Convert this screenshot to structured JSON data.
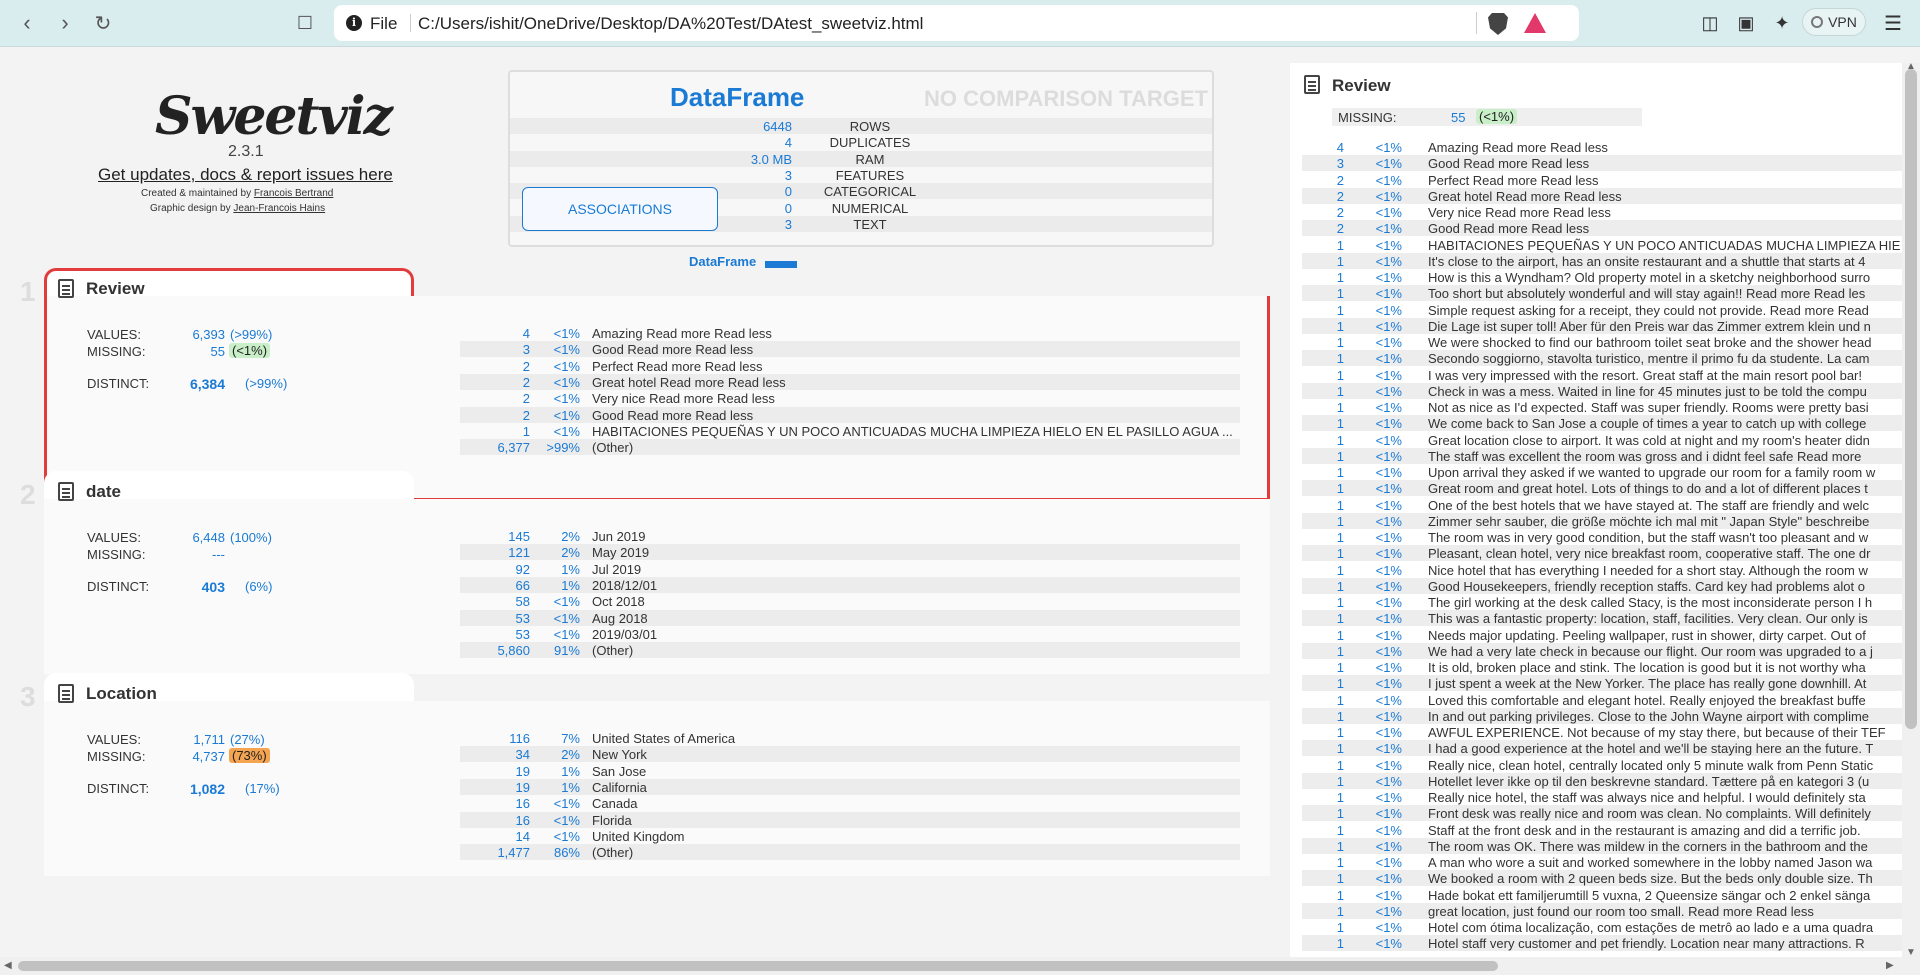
{
  "browser": {
    "scheme": "File",
    "url": "C:/Users/ishit/OneDrive/Desktop/DA%20Test/DAtest_sweetviz.html",
    "vpn_label": "VPN"
  },
  "header": {
    "logo": "Sweetviz",
    "version": "2.3.1",
    "updates_link": "Get updates, docs & report issues here",
    "created_prefix": "Created & maintained by",
    "created_by": "Francois Bertrand",
    "design_prefix": "Graphic design by",
    "design_by": "Jean-Francois Hains"
  },
  "summary": {
    "title": "DataFrame",
    "no_comparison": "NO COMPARISON TARGET",
    "rows": [
      {
        "value": "6448",
        "label": "ROWS"
      },
      {
        "value": "4",
        "label": "DUPLICATES"
      },
      {
        "value": "3.0 MB",
        "label": "RAM"
      },
      {
        "value": "3",
        "label": "FEATURES"
      },
      {
        "value": "0",
        "label": "CATEGORICAL"
      },
      {
        "value": "0",
        "label": "NUMERICAL"
      },
      {
        "value": "3",
        "label": "TEXT"
      }
    ],
    "associations_label": "ASSOCIATIONS",
    "legend_label": "DataFrame",
    "accent": "#1a7ad4"
  },
  "features": [
    {
      "index": "1",
      "name": "Review",
      "values_label": "VALUES:",
      "values": "6,393",
      "values_pct": "(>99%)",
      "missing_label": "MISSING:",
      "missing": "55",
      "missing_pct": "(<1%)",
      "distinct_label": "DISTINCT:",
      "distinct": "6,384",
      "distinct_pct": "(>99%)",
      "freq": [
        {
          "count": "4",
          "pct": "<1%",
          "text": "Amazing Read more Read less"
        },
        {
          "count": "3",
          "pct": "<1%",
          "text": "Good Read more Read less"
        },
        {
          "count": "2",
          "pct": "<1%",
          "text": "Perfect Read more Read less"
        },
        {
          "count": "2",
          "pct": "<1%",
          "text": "Great hotel Read more Read less"
        },
        {
          "count": "2",
          "pct": "<1%",
          "text": "Very nice Read more Read less"
        },
        {
          "count": "2",
          "pct": "<1%",
          "text": "Good Read more Read less"
        },
        {
          "count": "1",
          "pct": "<1%",
          "text": "HABITACIONES PEQUEÑAS Y UN POCO ANTICUADAS MUCHA LIMPIEZA HIELO EN EL PASILLO AGUA ..."
        },
        {
          "count": "6,377",
          "pct": ">99%",
          "text": "(Other)"
        }
      ]
    },
    {
      "index": "2",
      "name": "date",
      "values_label": "VALUES:",
      "values": "6,448",
      "values_pct": "(100%)",
      "missing_label": "MISSING:",
      "missing": "---",
      "missing_pct": "",
      "distinct_label": "DISTINCT:",
      "distinct": "403",
      "distinct_pct": "(6%)",
      "freq": [
        {
          "count": "145",
          "pct": "2%",
          "text": "Jun 2019"
        },
        {
          "count": "121",
          "pct": "2%",
          "text": "May 2019"
        },
        {
          "count": "92",
          "pct": "1%",
          "text": "Jul 2019"
        },
        {
          "count": "66",
          "pct": "1%",
          "text": "2018/12/01"
        },
        {
          "count": "58",
          "pct": "<1%",
          "text": "Oct 2018"
        },
        {
          "count": "53",
          "pct": "<1%",
          "text": "Aug 2018"
        },
        {
          "count": "53",
          "pct": "<1%",
          "text": "2019/03/01"
        },
        {
          "count": "5,860",
          "pct": "91%",
          "text": "(Other)"
        }
      ]
    },
    {
      "index": "3",
      "name": "Location",
      "values_label": "VALUES:",
      "values": "1,711",
      "values_pct": "(27%)",
      "missing_label": "MISSING:",
      "missing": "4,737",
      "missing_pct": "(73%)",
      "distinct_label": "DISTINCT:",
      "distinct": "1,082",
      "distinct_pct": "(17%)",
      "freq": [
        {
          "count": "116",
          "pct": "7%",
          "text": "United States of America"
        },
        {
          "count": "34",
          "pct": "2%",
          "text": "New York"
        },
        {
          "count": "19",
          "pct": "1%",
          "text": "San Jose"
        },
        {
          "count": "19",
          "pct": "1%",
          "text": "California"
        },
        {
          "count": "16",
          "pct": "<1%",
          "text": "Canada"
        },
        {
          "count": "16",
          "pct": "<1%",
          "text": "Florida"
        },
        {
          "count": "14",
          "pct": "<1%",
          "text": "United Kingdom"
        },
        {
          "count": "1,477",
          "pct": "86%",
          "text": "(Other)"
        }
      ]
    }
  ],
  "detail": {
    "title": "Review",
    "missing_label": "MISSING:",
    "missing": "55",
    "missing_pct": "(<1%)",
    "rows": [
      {
        "count": "4",
        "pct": "<1%",
        "text": "Amazing Read more Read less"
      },
      {
        "count": "3",
        "pct": "<1%",
        "text": "Good Read more Read less"
      },
      {
        "count": "2",
        "pct": "<1%",
        "text": "Perfect Read more Read less"
      },
      {
        "count": "2",
        "pct": "<1%",
        "text": "Great hotel Read more Read less"
      },
      {
        "count": "2",
        "pct": "<1%",
        "text": "Very nice Read more Read less"
      },
      {
        "count": "2",
        "pct": "<1%",
        "text": "Good Read more Read less"
      },
      {
        "count": "1",
        "pct": "<1%",
        "text": "HABITACIONES PEQUEÑAS Y UN POCO ANTICUADAS MUCHA LIMPIEZA HIE"
      },
      {
        "count": "1",
        "pct": "<1%",
        "text": "It's close to the airport, has an onsite restaurant and a shuttle that starts at 4"
      },
      {
        "count": "1",
        "pct": "<1%",
        "text": "How is this a Wyndham? Old property motel in a sketchy neighborhood surro"
      },
      {
        "count": "1",
        "pct": "<1%",
        "text": "Too short but absolutely wonderful and will stay again!! Read more Read les"
      },
      {
        "count": "1",
        "pct": "<1%",
        "text": "Simple request asking for a receipt, they could not provide. Read more Read"
      },
      {
        "count": "1",
        "pct": "<1%",
        "text": "Die Lage ist super toll! Aber für den Preis war das Zimmer extrem klein und n"
      },
      {
        "count": "1",
        "pct": "<1%",
        "text": "We were shocked to find our bathroom toilet seat broke and the shower head"
      },
      {
        "count": "1",
        "pct": "<1%",
        "text": "Secondo soggiorno, stavolta turistico, mentre il primo fu da studente. La cam"
      },
      {
        "count": "1",
        "pct": "<1%",
        "text": "I was very impressed with the resort. Great staff at the main resort pool bar!"
      },
      {
        "count": "1",
        "pct": "<1%",
        "text": "Check in was a mess. Waited in line for 45 minutes just to be told the compu"
      },
      {
        "count": "1",
        "pct": "<1%",
        "text": "Not as nice as I'd expected. Staff was super friendly. Rooms were pretty basi"
      },
      {
        "count": "1",
        "pct": "<1%",
        "text": "We come back to San Jose a couple of times a year to catch up with college"
      },
      {
        "count": "1",
        "pct": "<1%",
        "text": "Great location close to airport. It was cold at night and my room's heater didn"
      },
      {
        "count": "1",
        "pct": "<1%",
        "text": "The staff was excellent the room was gross and i didnt feel safe Read more"
      },
      {
        "count": "1",
        "pct": "<1%",
        "text": "Upon arrival they asked if we wanted to upgrade our room for a family room w"
      },
      {
        "count": "1",
        "pct": "<1%",
        "text": "Great room and great hotel. Lots of things to do and a lot of different places t"
      },
      {
        "count": "1",
        "pct": "<1%",
        "text": "One of the best hotels that we have stayed at. The staff are friendly and welc"
      },
      {
        "count": "1",
        "pct": "<1%",
        "text": "Zimmer sehr sauber, die größe möchte ich mal mit \" Japan Style\" beschreibe"
      },
      {
        "count": "1",
        "pct": "<1%",
        "text": "The room was in very good condition, but the staff wasn't too pleasant and w"
      },
      {
        "count": "1",
        "pct": "<1%",
        "text": "Pleasant, clean hotel, very nice breakfast room, cooperative staff. The one dr"
      },
      {
        "count": "1",
        "pct": "<1%",
        "text": "Nice hotel that has everything I needed for a short stay. Although the room w"
      },
      {
        "count": "1",
        "pct": "<1%",
        "text": "Good Housekeepers, friendly reception staffs. Card key had problems alot o"
      },
      {
        "count": "1",
        "pct": "<1%",
        "text": "The girl working at the desk called Stacy, is the most inconsiderate person I h"
      },
      {
        "count": "1",
        "pct": "<1%",
        "text": "This was a fantastic property: location, staff, facilities. Very clean. Our only is"
      },
      {
        "count": "1",
        "pct": "<1%",
        "text": "Needs major updating. Peeling wallpaper, rust in shower, dirty carpet. Out of"
      },
      {
        "count": "1",
        "pct": "<1%",
        "text": "We had a very late check in because our flight. Our room was upgraded to a j"
      },
      {
        "count": "1",
        "pct": "<1%",
        "text": "It is old, broken place and stink. The location is good but it is not worthy wha"
      },
      {
        "count": "1",
        "pct": "<1%",
        "text": "I just spent a week at the New Yorker. The place has really gone downhill. At"
      },
      {
        "count": "1",
        "pct": "<1%",
        "text": "Loved this comfortable and elegant hotel. Really enjoyed the breakfast buffe"
      },
      {
        "count": "1",
        "pct": "<1%",
        "text": "In and out parking privileges. Close to the John Wayne airport with complime"
      },
      {
        "count": "1",
        "pct": "<1%",
        "text": "AWFUL EXPERIENCE. Not because of my stay there, but because of their TEF"
      },
      {
        "count": "1",
        "pct": "<1%",
        "text": "I had a good experience at the hotel and we'll be staying here an the future. T"
      },
      {
        "count": "1",
        "pct": "<1%",
        "text": "Really nice, clean hotel, centrally located only 5 minute walk from Penn Static"
      },
      {
        "count": "1",
        "pct": "<1%",
        "text": "Hotellet lever ikke op til den beskrevne standard. Tættere på en kategori 3 (u"
      },
      {
        "count": "1",
        "pct": "<1%",
        "text": "Really nice hotel, the staff was always nice and helpful. I would definitely sta"
      },
      {
        "count": "1",
        "pct": "<1%",
        "text": "Front desk was really nice and room was clean. No complaints. Will definitely"
      },
      {
        "count": "1",
        "pct": "<1%",
        "text": "Staff at the front desk and in the restaurant is amazing and did a terrific job."
      },
      {
        "count": "1",
        "pct": "<1%",
        "text": "The room was OK. There was mildew in the corners in the bathroom and the"
      },
      {
        "count": "1",
        "pct": "<1%",
        "text": "A man who wore a suit and worked somewhere in the lobby named Jason wa"
      },
      {
        "count": "1",
        "pct": "<1%",
        "text": "We booked a room with 2 queen beds size. But the beds only double size. Th"
      },
      {
        "count": "1",
        "pct": "<1%",
        "text": "Hade bokat ett familjerumtill 5 vuxna, 2 Queensize sängar och 2 enkel sänga"
      },
      {
        "count": "1",
        "pct": "<1%",
        "text": "great location, just found our room too small. Read more Read less"
      },
      {
        "count": "1",
        "pct": "<1%",
        "text": "Hotel com ótima localização, com estações de metrô ao lado e a uma quadra"
      },
      {
        "count": "1",
        "pct": "<1%",
        "text": "Hotel staff very customer and pet friendly. Location near many attractions. R"
      }
    ]
  }
}
